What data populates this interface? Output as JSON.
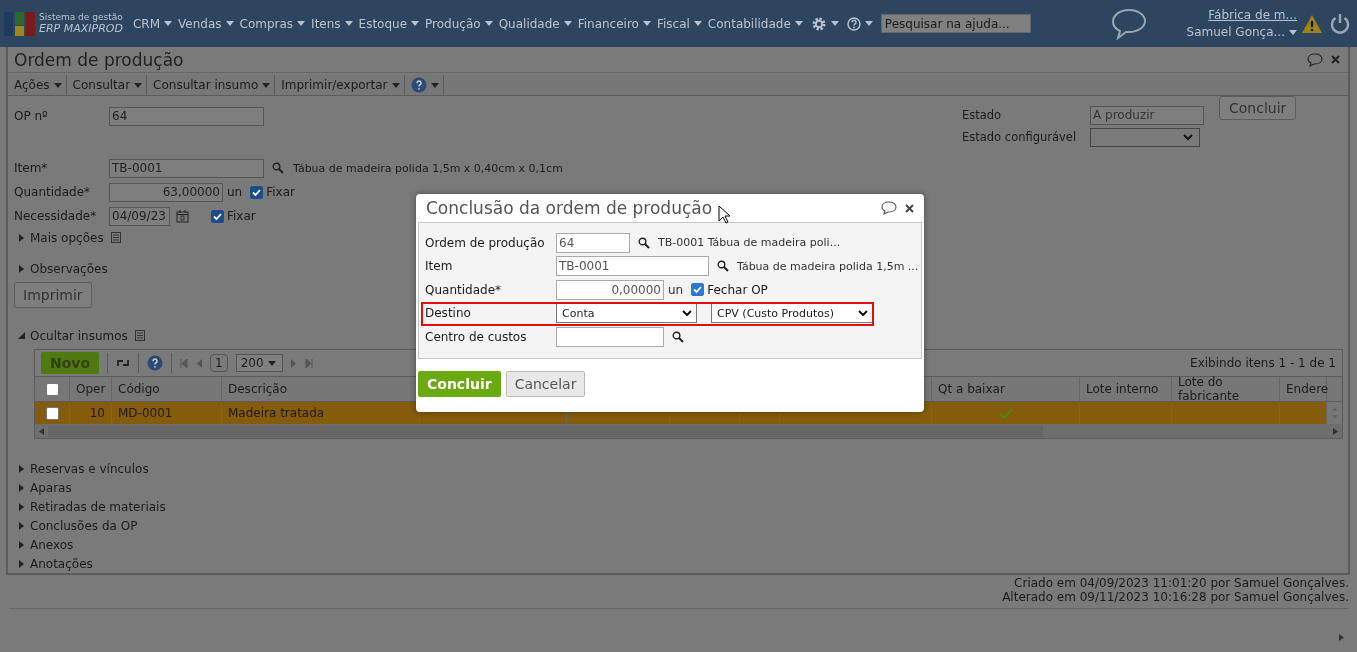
{
  "topbar": {
    "logo_line1": "Sistema de gestão",
    "logo_line2": "ERP MAXIPROD",
    "menus": [
      "CRM",
      "Vendas",
      "Compras",
      "Itens",
      "Estoque",
      "Produção",
      "Qualidade",
      "Financeiro",
      "Fiscal",
      "Contabilidade"
    ],
    "search": {
      "placeholder": "Pesquisar na ajuda..."
    },
    "company": "Fábrica de m...",
    "user": "Samuel Gonça..."
  },
  "window": {
    "title": "Ordem de produção"
  },
  "toolbar": [
    "Ações",
    "Consultar",
    "Consultar insumo",
    "Imprimir/exportar"
  ],
  "form": {
    "op_label": "OP nº",
    "op_value": "64",
    "item_label": "Item*",
    "item_value": "TB-0001",
    "item_desc": "Tábua de madeira polida 1,5m x 0,40cm x 0,1cm",
    "qty_label": "Quantidade*",
    "qty_value": "63,00000",
    "qty_unit": "un",
    "qty_fix": {
      "label": "Fixar",
      "checked": true
    },
    "need_label": "Necessidade*",
    "need_value": "04/09/23",
    "need_fix": {
      "label": "Fixar",
      "checked": true
    },
    "state_label": "Estado",
    "state_value": "A produzir",
    "conf_label": "Estado configurável",
    "conclude": "Concluir",
    "more": {
      "label": "Mais opções",
      "expanded": false
    },
    "notes": {
      "label": "Observações",
      "expanded": false
    },
    "print": "Imprimir"
  },
  "inputs": {
    "section": {
      "label": "Ocultar insumos",
      "expanded": true
    },
    "new": "Novo",
    "page": "1",
    "page_size": "200",
    "summary": "Exibindo itens 1 - 1 de 1",
    "all_checked": false,
    "columns": [
      "Oper",
      "Código",
      "Descrição",
      "",
      "",
      "",
      "",
      "",
      "Qt a baixar",
      "Lote interno",
      "Lote do fabricante",
      "Endere"
    ],
    "rows": [
      {
        "checked": false,
        "selected": true,
        "oper": "10",
        "code": "MD-0001",
        "desc": "Madeira tratada",
        "done": true
      }
    ]
  },
  "sections": [
    {
      "label": "Reservas e vínculos",
      "expanded": false
    },
    {
      "label": "Aparas",
      "expanded": false
    },
    {
      "label": "Retiradas de materiais",
      "expanded": false
    },
    {
      "label": "Conclusões da OP",
      "expanded": false
    },
    {
      "label": "Anexos",
      "expanded": false
    },
    {
      "label": "Anotações",
      "expanded": false
    }
  ],
  "footer": [
    "Criado em 04/09/2023 11:01:20 por Samuel Gonçalves.",
    "Alterado em 09/11/2023 10:16:28 por Samuel Gonçalves."
  ],
  "dialog": {
    "title": "Conclusão da ordem de produção",
    "fields": [
      {
        "kind": "lookup",
        "label": "Ordem de produção",
        "value": "64",
        "desc": "TB-0001 Tábua de madeira poli..."
      },
      {
        "kind": "lookup",
        "label": "Item",
        "value": "TB-0001",
        "desc": "Tábua de madeira polida 1,5m ..."
      },
      {
        "kind": "quantity",
        "label": "Quantidade*",
        "value": "0,00000",
        "unit": "un",
        "check": {
          "label": "Fechar OP",
          "checked": true
        }
      },
      {
        "kind": "selects",
        "label": "Destino",
        "value": "Conta",
        "value2": "CPV (Custo Produtos)",
        "highlighted": true
      },
      {
        "kind": "lookup",
        "label": "Centro de custos"
      }
    ],
    "ok": "Concluir",
    "cancel": "Cancelar"
  }
}
